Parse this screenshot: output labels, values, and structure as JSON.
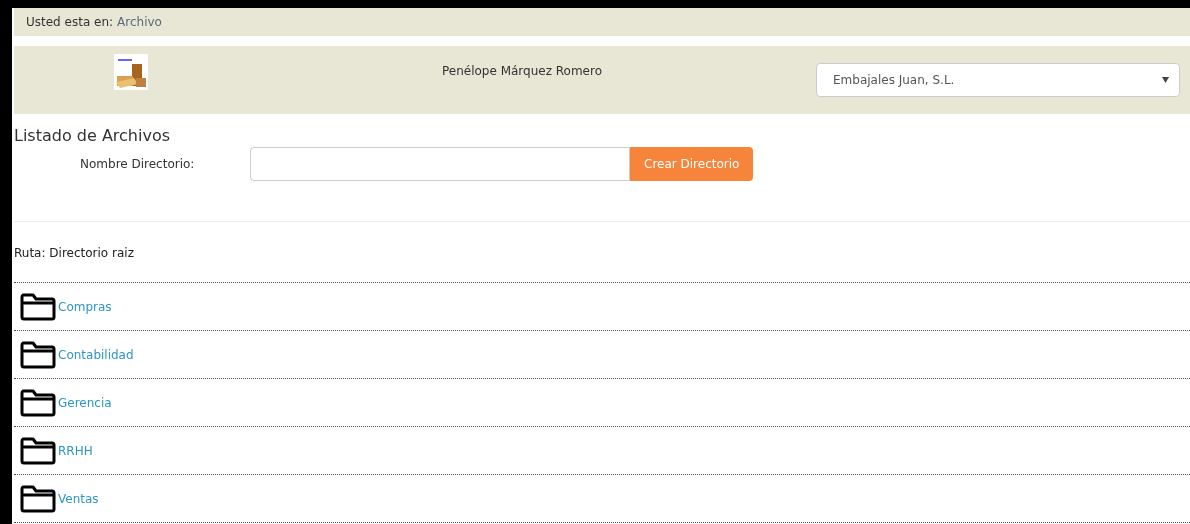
{
  "breadcrumb": {
    "label": "Usted esta en:",
    "current": "Archivo"
  },
  "header": {
    "user": "Penélope Márquez Romero",
    "company_select": {
      "value": "Embajales Juan, S.L."
    }
  },
  "title": "Listado de Archivos",
  "form": {
    "label": "Nombre Directorio:",
    "button": "Crear Directorio"
  },
  "path": "Ruta: Directorio raiz",
  "folders": [
    {
      "name": "Compras"
    },
    {
      "name": "Contabilidad"
    },
    {
      "name": "Gerencia"
    },
    {
      "name": "RRHH"
    },
    {
      "name": "Ventas"
    }
  ]
}
